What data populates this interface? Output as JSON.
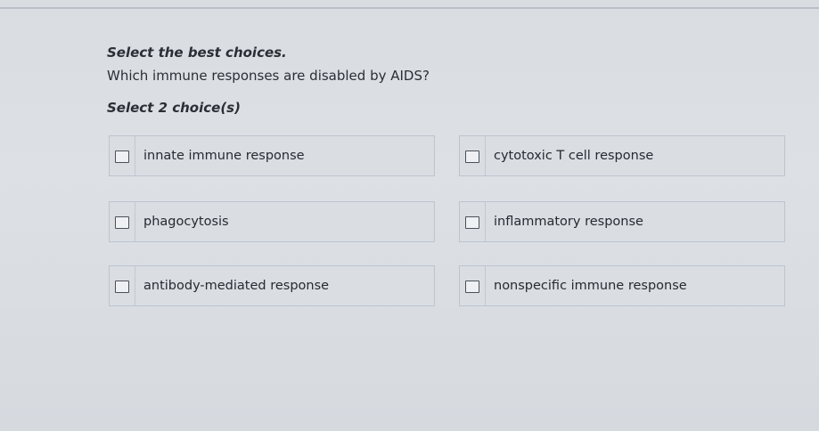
{
  "prompt": "Select the best choices.",
  "question": "Which immune responses are disabled by AIDS?",
  "select_count": "Select 2 choice(s)",
  "choices": [
    {
      "label": "innate immune response",
      "checked": false
    },
    {
      "label": "cytotoxic T cell response",
      "checked": false
    },
    {
      "label": "phagocytosis",
      "checked": false
    },
    {
      "label": "inflammatory response",
      "checked": false
    },
    {
      "label": "antibody-mediated response",
      "checked": false
    },
    {
      "label": "nonspecific immune response",
      "checked": false
    }
  ]
}
